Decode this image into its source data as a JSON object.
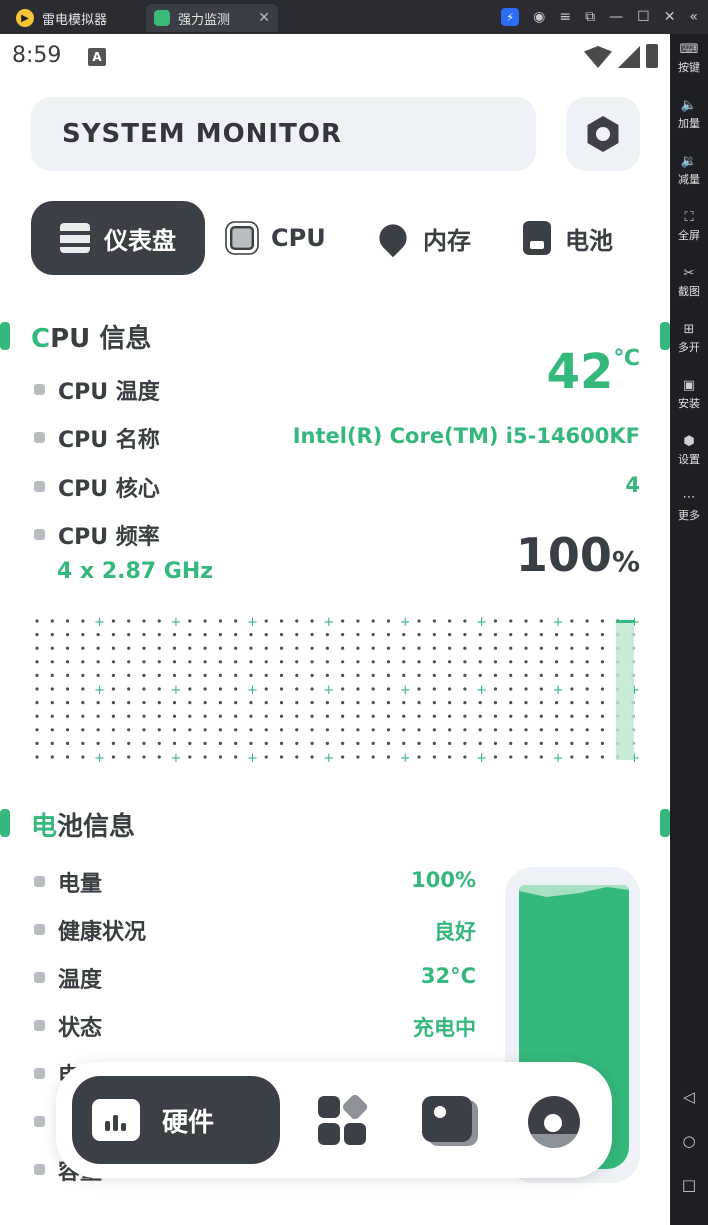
{
  "emulator": {
    "app_name": "雷电模拟器",
    "tab_title": "强力监测",
    "sidebar": [
      {
        "label": "按键"
      },
      {
        "label": "加量"
      },
      {
        "label": "减量"
      },
      {
        "label": "全屏"
      },
      {
        "label": "截图"
      },
      {
        "label": "多开"
      },
      {
        "label": "安装"
      },
      {
        "label": "设置"
      },
      {
        "label": "更多"
      }
    ]
  },
  "statusbar": {
    "time": "8:59",
    "notif": "A"
  },
  "header": {
    "title": "SYSTEM MONITOR"
  },
  "tabs": [
    {
      "label": "仪表盘"
    },
    {
      "label": "CPU"
    },
    {
      "label": "内存"
    },
    {
      "label": "电池"
    }
  ],
  "cpu": {
    "section_accent": "C",
    "section_rest": "PU 信息",
    "temp_label": "CPU 温度",
    "temp_value": "42",
    "temp_unit": "℃",
    "name_label": "CPU 名称",
    "name_value": "Intel(R) Core(TM) i5-14600KF",
    "cores_label": "CPU 核心",
    "cores_value": "4",
    "freq_label": "CPU 频率",
    "freq_value": "4 x 2.87 GHz",
    "usage_value": "100",
    "usage_unit": "%",
    "usage_fraction": 1.0
  },
  "battery": {
    "section_accent": "电",
    "section_rest": "池信息",
    "rows": [
      {
        "label": "电量",
        "value": "100%"
      },
      {
        "label": "健康状况",
        "value": "良好"
      },
      {
        "label": "温度",
        "value": "32°C"
      },
      {
        "label": "状态",
        "value": "充电中"
      }
    ],
    "partial_row_1": "电",
    "partial_row_3": "容量",
    "level_fraction": 1.0
  },
  "bottom_nav": {
    "active_label": "硬件"
  },
  "colors": {
    "accent": "#35b87b",
    "dark": "#3b3f46",
    "card": "#eef1f5"
  }
}
